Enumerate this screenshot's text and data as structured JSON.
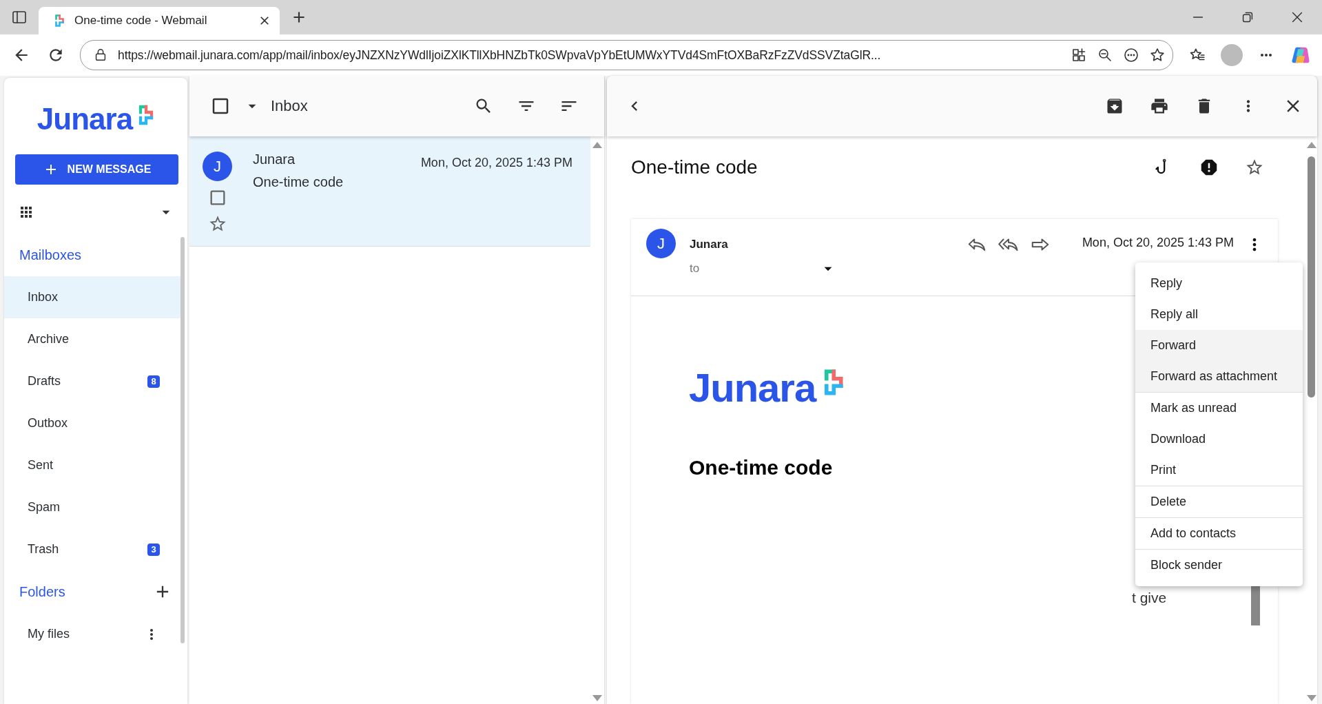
{
  "browser": {
    "tab_title": "One-time code - Webmail",
    "url": "https://webmail.junara.com/app/mail/inbox/eyJNZXNzYWdlIjoiZXlKTllXbHNZbTk0SWpvaVpYbEtUMWxYTVd4SmFtOXBaRzFzZVdSSVZtaGlR..."
  },
  "sidebar": {
    "logo": "Junara",
    "new_message": "NEW MESSAGE",
    "mailboxes_heading": "Mailboxes",
    "mailboxes": [
      {
        "label": "Inbox",
        "selected": true
      },
      {
        "label": "Archive",
        "selected": false
      },
      {
        "label": "Drafts",
        "selected": false,
        "badge": "8"
      },
      {
        "label": "Outbox",
        "selected": false
      },
      {
        "label": "Sent",
        "selected": false
      },
      {
        "label": "Spam",
        "selected": false
      },
      {
        "label": "Trash",
        "selected": false,
        "badge": "3"
      }
    ],
    "folders_heading": "Folders",
    "folders": [
      {
        "label": "My files"
      }
    ]
  },
  "message_list": {
    "title": "Inbox",
    "select_all_checked": false,
    "messages": [
      {
        "initial": "J",
        "sender": "Junara",
        "subject": "One-time code",
        "date": "Mon, Oct 20, 2025 1:43 PM",
        "selected": true,
        "checked": false,
        "starred": false
      }
    ]
  },
  "reader": {
    "subject": "One-time code",
    "starred": false,
    "message": {
      "initial": "J",
      "sender": "Junara",
      "to_label": "to",
      "date": "Mon, Oct 20, 2025 1:43 PM",
      "body": {
        "logo": "Junara",
        "heading": "One-time code",
        "fragment": "t give"
      }
    },
    "menu": {
      "groups": [
        [
          {
            "label": "Reply",
            "highlighted": false
          },
          {
            "label": "Reply all",
            "highlighted": false
          },
          {
            "label": "Forward",
            "highlighted": true
          },
          {
            "label": "Forward as attachment",
            "highlighted": true
          }
        ],
        [
          {
            "label": "Mark as unread",
            "highlighted": false
          },
          {
            "label": "Download",
            "highlighted": false
          },
          {
            "label": "Print",
            "highlighted": false
          }
        ],
        [
          {
            "label": "Delete",
            "highlighted": false
          }
        ],
        [
          {
            "label": "Add to contacts",
            "highlighted": false
          }
        ],
        [
          {
            "label": "Block sender",
            "highlighted": false
          }
        ]
      ]
    }
  }
}
